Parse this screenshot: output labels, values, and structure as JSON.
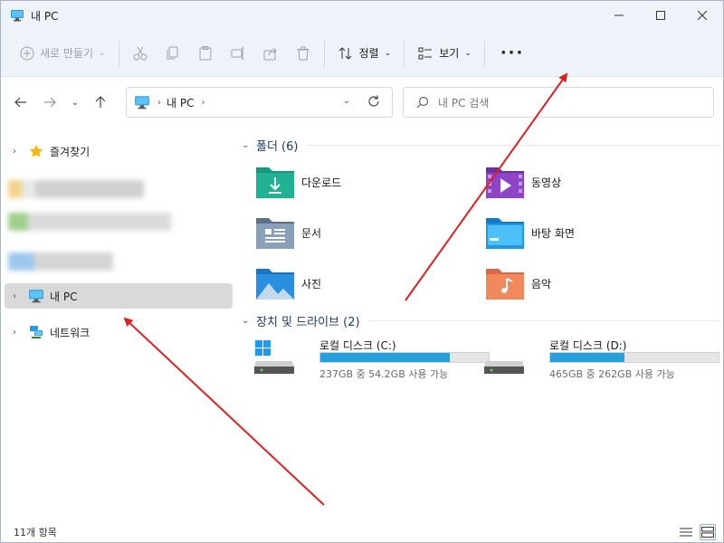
{
  "window": {
    "title": "내 PC"
  },
  "commandbar": {
    "new_label": "새로 만들기",
    "sort_label": "정렬",
    "view_label": "보기",
    "more_label": "···"
  },
  "navbar": {
    "address_crumb": "내 PC",
    "search_placeholder": "내 PC 검색"
  },
  "sidebar": {
    "favorites": "즐겨찾기",
    "this_pc": "내 PC",
    "network": "네트워크"
  },
  "content": {
    "folders_header": "폴더 (6)",
    "folders": [
      {
        "name": "다운로드",
        "icon": "download-folder-icon"
      },
      {
        "name": "동영상",
        "icon": "video-folder-icon"
      },
      {
        "name": "문서",
        "icon": "documents-folder-icon"
      },
      {
        "name": "바탕 화면",
        "icon": "desktop-folder-icon"
      },
      {
        "name": "사진",
        "icon": "pictures-folder-icon"
      },
      {
        "name": "음악",
        "icon": "music-folder-icon"
      }
    ],
    "drives_header": "장치 및 드라이브 (2)",
    "drives": [
      {
        "name": "로컬 디스크 (C:)",
        "info": "237GB 중 54.2GB 사용 가능",
        "used_fraction": 0.77
      },
      {
        "name": "로컬 디스크 (D:)",
        "info": "465GB 중 262GB 사용 가능",
        "used_fraction": 0.44
      }
    ]
  },
  "status": {
    "item_count": "11개 항목"
  },
  "colors": {
    "accent": "#26a0da",
    "annotation": "#e02020",
    "chrome": "#eef3f9"
  }
}
